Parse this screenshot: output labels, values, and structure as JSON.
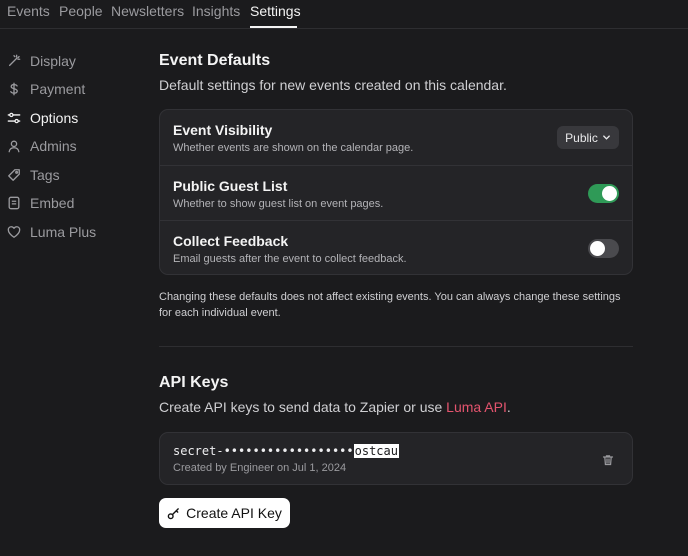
{
  "topnav": {
    "tabs": [
      {
        "label": "Events"
      },
      {
        "label": "People"
      },
      {
        "label": "Newsletters"
      },
      {
        "label": "Insights"
      },
      {
        "label": "Settings",
        "active": true
      }
    ]
  },
  "sidebar": {
    "items": [
      {
        "label": "Display",
        "icon": "wand-icon"
      },
      {
        "label": "Payment",
        "icon": "dollar-icon"
      },
      {
        "label": "Options",
        "icon": "sliders-icon",
        "active": true
      },
      {
        "label": "Admins",
        "icon": "user-icon"
      },
      {
        "label": "Tags",
        "icon": "tag-icon"
      },
      {
        "label": "Embed",
        "icon": "embed-icon"
      },
      {
        "label": "Luma Plus",
        "icon": "heart-icon"
      }
    ]
  },
  "event_defaults": {
    "title": "Event Defaults",
    "subtitle": "Default settings for new events created on this calendar.",
    "rows": [
      {
        "title": "Event Visibility",
        "desc": "Whether events are shown on the calendar page.",
        "control": "dropdown",
        "value": "Public"
      },
      {
        "title": "Public Guest List",
        "desc": "Whether to show guest list on event pages.",
        "control": "toggle",
        "on": true
      },
      {
        "title": "Collect Feedback",
        "desc": "Email guests after the event to collect feedback.",
        "control": "toggle",
        "on": false
      }
    ],
    "note": "Changing these defaults does not affect existing events. You can always change these settings for each individual event."
  },
  "api_keys": {
    "title": "API Keys",
    "subtitle_prefix": "Create API keys to send data to Zapier or use ",
    "subtitle_link": "Luma API",
    "subtitle_suffix": ".",
    "key": {
      "prefix": "secret-",
      "masked": "••••••••••••••••••",
      "redacted": "ostcau",
      "meta": "Created by Engineer on Jul 1, 2024"
    },
    "create_button": "Create API Key"
  },
  "colors": {
    "background": "#1b1b1d",
    "card": "#242427",
    "toggle_on": "#2f9a57",
    "link": "#e4546e"
  }
}
